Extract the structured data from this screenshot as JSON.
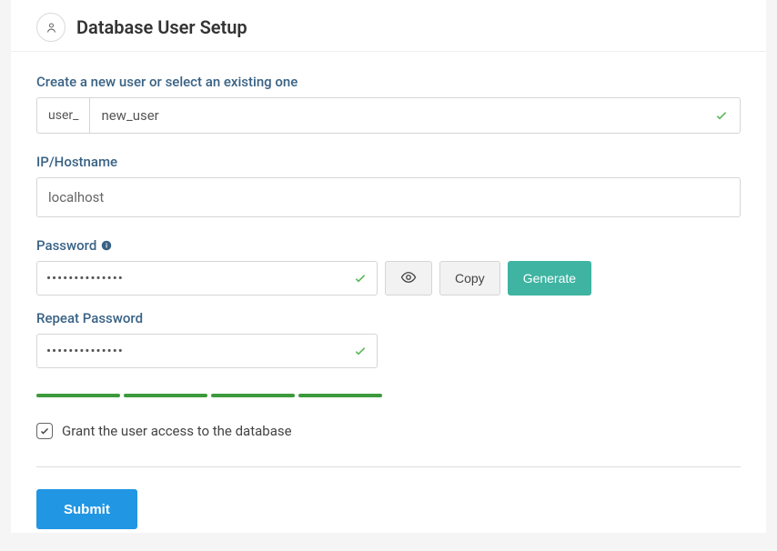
{
  "header": {
    "title": "Database User Setup"
  },
  "user": {
    "label": "Create a new user or select an existing one",
    "prefix": "user_",
    "value": "new_user"
  },
  "host": {
    "label": "IP/Hostname",
    "value": "localhost"
  },
  "password": {
    "label": "Password",
    "value": "••••••••••••••",
    "repeat_label": "Repeat Password",
    "repeat_value": "••••••••••••••",
    "copy_label": "Copy",
    "generate_label": "Generate"
  },
  "grant": {
    "label": "Grant the user access to the database",
    "checked": true
  },
  "submit": {
    "label": "Submit"
  },
  "colors": {
    "accent_blue": "#2196e3",
    "accent_teal": "#3fb4a2",
    "label_blue": "#396285",
    "success_green": "#5cb85c"
  }
}
